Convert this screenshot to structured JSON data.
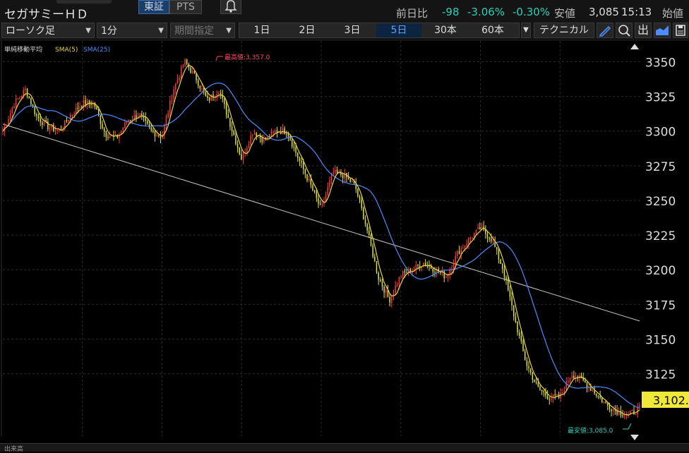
{
  "header": {
    "stock_name": "セガサミーＨＤ",
    "market_tosho": "東証",
    "market_pts": "PTS",
    "change_label": "前日比",
    "change_value": "-98",
    "change_pct": "-3.06%",
    "index_pct": "-0.30%",
    "low_label": "安値",
    "low_value": "3,085",
    "time": "15:13",
    "open_label": "始値",
    "change_color": "#2fd0b8"
  },
  "toolbar": {
    "chart_type": "ローソク足",
    "interval": "1分",
    "period_select": "期間指定",
    "ranges": [
      "1日",
      "2日",
      "3日",
      "5日",
      "30本",
      "60本"
    ],
    "active_range": "5日",
    "technical": "テクニカル",
    "icons": [
      "pen-icon",
      "zoom-icon",
      "output-icon",
      "chart-style-icon",
      "save-icon"
    ],
    "output_label": "出"
  },
  "chart_data": {
    "type": "candlestick",
    "indicator_title": "単純移動平均",
    "series": [
      {
        "name": "SMA(5)",
        "color": "#e8d44a"
      },
      {
        "name": "SMA(25)",
        "color": "#4d8cff"
      }
    ],
    "ylim": [
      3080,
      3365
    ],
    "y_ticks": [
      3125,
      3150,
      3175,
      3200,
      3225,
      3250,
      3275,
      3300,
      3325,
      3350
    ],
    "high_label": "最高値:3,357.0",
    "high_value": 3357.0,
    "low_label": "最安値:3,085.0",
    "low_value": 3085.0,
    "current_price_label": "3,102.",
    "up_color": "#ff3b3b",
    "down_color": "#e0e63a",
    "anchors": [
      [
        0,
        3300
      ],
      [
        3,
        3320
      ],
      [
        6,
        3330
      ],
      [
        9,
        3310
      ],
      [
        12,
        3303
      ],
      [
        15,
        3300
      ],
      [
        18,
        3312
      ],
      [
        21,
        3320
      ],
      [
        24,
        3320
      ],
      [
        27,
        3298
      ],
      [
        30,
        3295
      ],
      [
        33,
        3308
      ],
      [
        36,
        3312
      ],
      [
        39,
        3300
      ],
      [
        42,
        3296
      ],
      [
        45,
        3330
      ],
      [
        48,
        3350
      ],
      [
        51,
        3338
      ],
      [
        54,
        3322
      ],
      [
        57,
        3330
      ],
      [
        60,
        3305
      ],
      [
        63,
        3280
      ],
      [
        66,
        3300
      ],
      [
        69,
        3293
      ],
      [
        72,
        3300
      ],
      [
        75,
        3300
      ],
      [
        78,
        3280
      ],
      [
        81,
        3262
      ],
      [
        84,
        3243
      ],
      [
        87,
        3270
      ],
      [
        90,
        3268
      ],
      [
        93,
        3260
      ],
      [
        96,
        3230
      ],
      [
        99,
        3195
      ],
      [
        102,
        3178
      ],
      [
        105,
        3196
      ],
      [
        108,
        3200
      ],
      [
        111,
        3205
      ],
      [
        114,
        3200
      ],
      [
        117,
        3195
      ],
      [
        120,
        3212
      ],
      [
        123,
        3222
      ],
      [
        126,
        3230
      ],
      [
        129,
        3222
      ],
      [
        132,
        3200
      ],
      [
        135,
        3165
      ],
      [
        138,
        3133
      ],
      [
        141,
        3115
      ],
      [
        144,
        3108
      ],
      [
        147,
        3108
      ],
      [
        150,
        3125
      ],
      [
        153,
        3120
      ],
      [
        156,
        3112
      ],
      [
        159,
        3103
      ],
      [
        162,
        3098
      ],
      [
        165,
        3095
      ],
      [
        168,
        3100
      ]
    ],
    "trendline": [
      [
        0,
        3305
      ],
      [
        168,
        3163
      ]
    ]
  },
  "footer": {
    "volume_label": "出来高"
  }
}
